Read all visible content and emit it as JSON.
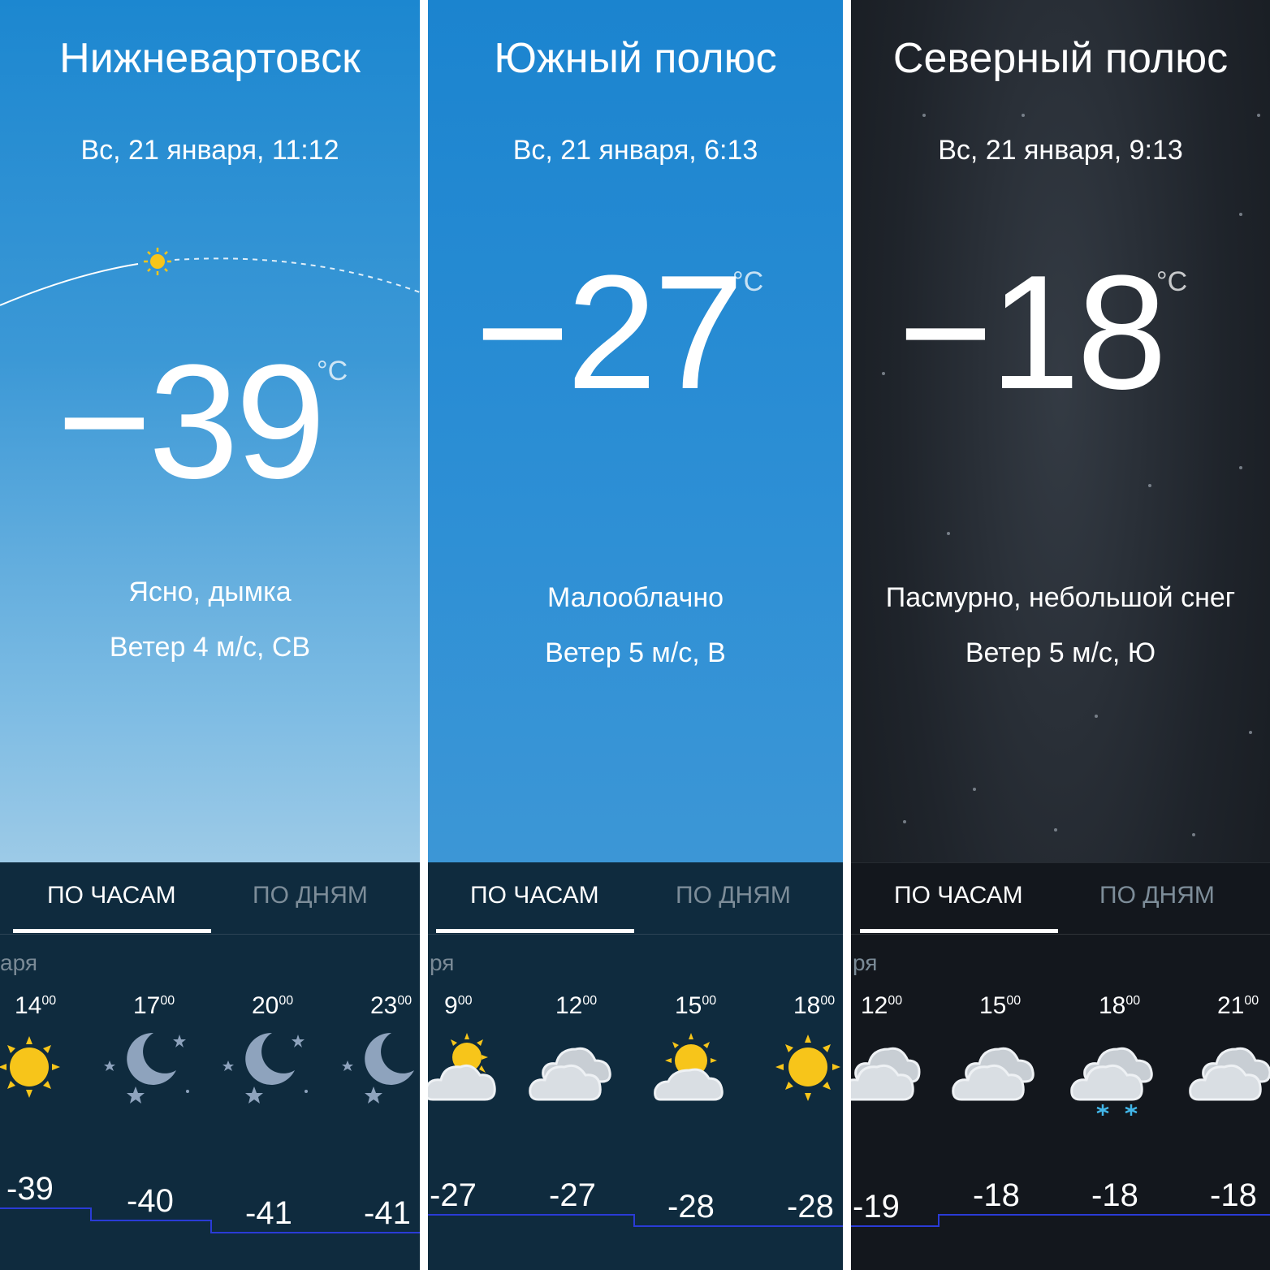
{
  "panels": [
    {
      "city": "Нижневартовск",
      "datetime": "Вс, 21 января, 11:12",
      "temp": "−39",
      "unit": "°C",
      "condition": "Ясно, дымка",
      "wind": "Ветер 4 м/с, СВ",
      "tab_hourly": "ПО ЧАСАМ",
      "tab_daily": "ПО ДНЯМ",
      "month_fragment": "аря",
      "hours": [
        {
          "h": "14",
          "m": "00",
          "t": "-39",
          "icon": "sun-icon"
        },
        {
          "h": "17",
          "m": "00",
          "t": "-40",
          "icon": "moon-icon"
        },
        {
          "h": "20",
          "m": "00",
          "t": "-41",
          "icon": "moon-icon"
        },
        {
          "h": "23",
          "m": "00",
          "t": "-41",
          "icon": "moon-icon"
        }
      ]
    },
    {
      "city": "Южный полюс",
      "datetime": "Вс, 21 января, 6:13",
      "temp": "−27",
      "unit": "°C",
      "condition": "Малооблачно",
      "wind": "Ветер 5 м/с, В",
      "tab_hourly": "ПО ЧАСАМ",
      "tab_daily": "ПО ДНЯМ",
      "month_fragment": "ря",
      "hours": [
        {
          "h": "9",
          "m": "00",
          "t": "-27",
          "icon": "partly-cloudy-icon"
        },
        {
          "h": "12",
          "m": "00",
          "t": "-27",
          "icon": "cloudy-icon"
        },
        {
          "h": "15",
          "m": "00",
          "t": "-28",
          "icon": "partly-cloudy-icon"
        },
        {
          "h": "18",
          "m": "00",
          "t": "-28",
          "icon": "sun-icon"
        }
      ]
    },
    {
      "city": "Северный полюс",
      "datetime": "Вс, 21 января, 9:13",
      "temp": "−18",
      "unit": "°C",
      "condition": "Пасмурно, небольшой снег",
      "wind": "Ветер 5 м/с, Ю",
      "tab_hourly": "ПО ЧАСАМ",
      "tab_daily": "ПО ДНЯМ",
      "month_fragment": "ря",
      "hours": [
        {
          "h": "12",
          "m": "00",
          "t": "-19",
          "icon": "cloudy-icon"
        },
        {
          "h": "15",
          "m": "00",
          "t": "-18",
          "icon": "cloudy-icon"
        },
        {
          "h": "18",
          "m": "00",
          "t": "-18",
          "icon": "snow-cloud-icon"
        },
        {
          "h": "21",
          "m": "00",
          "t": "-18",
          "icon": "cloudy-icon"
        }
      ]
    }
  ],
  "colors": {
    "bottom_blue": "#0f2b3e",
    "bottom_dark": "#13171d",
    "sun": "#f7c51a",
    "cloud": "#d9dee3",
    "moon": "#8ea3bd",
    "snow": "#42b6e8",
    "trend_line": "#2a3bd6"
  }
}
